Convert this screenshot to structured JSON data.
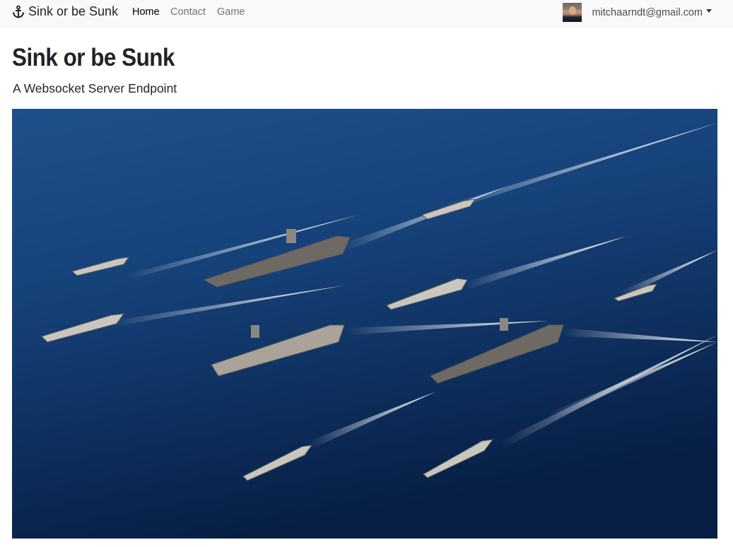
{
  "navbar": {
    "brand_label": "Sink or be Sunk",
    "brand_icon": "anchor-icon",
    "links": [
      {
        "label": "Home",
        "active": true
      },
      {
        "label": "Contact",
        "active": false
      },
      {
        "label": "Game",
        "active": false
      }
    ],
    "user": {
      "email": "mitchaarndt@gmail.com",
      "avatar_icon": "avatar-photo"
    }
  },
  "main": {
    "title": "Sink or be Sunk",
    "subtitle": "A Websocket Server Endpoint",
    "hero_image": "naval-fleet-photo"
  },
  "colors": {
    "navbar_bg": "#f8f9fa",
    "ocean_dark": "#0a2a55",
    "ocean_light": "#1f4f8a"
  }
}
